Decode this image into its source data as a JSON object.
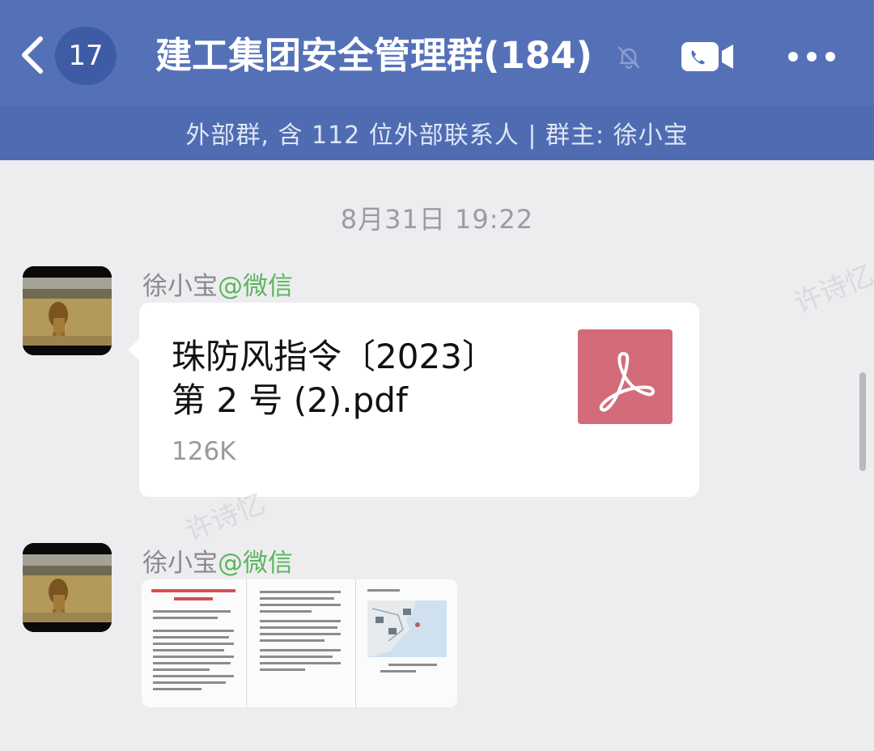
{
  "header": {
    "back_icon": "chevron-left-icon",
    "unread_count": "17",
    "title": "建工集团安全管理群(184)",
    "mute_icon": "bell-mute-icon",
    "video_icon": "video-call-icon",
    "more_icon": "more-dots-icon",
    "subtitle": "外部群, 含 112 位外部联系人 | 群主: 徐小宝",
    "background_color": "#5471b8"
  },
  "chat": {
    "timestamp": "8月31日 19:22",
    "messages": [
      {
        "sender_name": "徐小宝",
        "sender_tag": "@微信",
        "type": "file",
        "file_name_line1": "珠防风指令〔2023〕",
        "file_name_line2": "第 2 号 (2).pdf",
        "file_size": "126K",
        "file_icon": "pdf-icon",
        "file_icon_color": "#d46b7a"
      },
      {
        "sender_name": "徐小宝",
        "sender_tag": "@微信",
        "type": "document-preview",
        "page_count_shown": 3
      }
    ],
    "watermark": "许诗忆"
  }
}
